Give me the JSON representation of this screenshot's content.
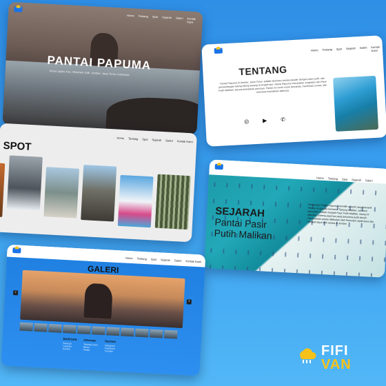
{
  "nav": [
    "Home",
    "Tentang",
    "Spot",
    "Sejarah",
    "Galeri",
    "Kontak Kami"
  ],
  "hero": {
    "title": "PANTAI PAPUMA",
    "subtitle": "Desa Lojejer, Kec. Wuluhan, Kab. Jember, Jawa Timur, Indonesia"
  },
  "tentang": {
    "title": "TENTANG",
    "text": "Pantai Papuma di Jember, Jawa Timur, adalah destinasi wisata populer dengan pasir putih, dan pemandangan tebing-tebing karang di tengah laut. Nama Papuma merupakan singkatan dari Pasir Putih Malikan, karena keindahan pasirnya. Pantai ini cocok untuk bersantai, menikmati sunset, dan memotret keindahan alamnya.",
    "icons": [
      "instagram-icon",
      "youtube-icon",
      "whatsapp-icon"
    ]
  },
  "spot": {
    "title": "SPOT"
  },
  "sejarah": {
    "title1": "SEJARAH",
    "title2_line1": "Pantai Pasir",
    "title2_line2": "Putih Malikan",
    "text": "Penamaan Pantai Papuma memiliki sejarah yang menarik. Pantai ini dulunya bernama Tanjung Malikan, sebelum kemudian diubah menjadi Pasir Putih Malikan. Nama ini diberikan karena pasirnya yang berwarna putih bersih. Pengelolaan pantai dilakukan oleh Perhutani sejak lama dan menjadi daya tarik wisata di Jember."
  },
  "galeri": {
    "title": "GALERI",
    "prev": "‹",
    "next": "›",
    "footer": [
      {
        "head": "BANTUAN",
        "items": [
          "Bantuan",
          "Layanan",
          "Kontak"
        ]
      },
      {
        "head": "Informasi",
        "items": [
          "Tentang Kami",
          "Berita",
          "Artikel"
        ]
      },
      {
        "head": "Sosmed",
        "items": [
          "Instagram",
          "Facebook",
          "Youtube"
        ]
      }
    ]
  },
  "brand": {
    "line1": "FIFI",
    "line2": "VAN",
    "yellow": "#f6c21a"
  }
}
